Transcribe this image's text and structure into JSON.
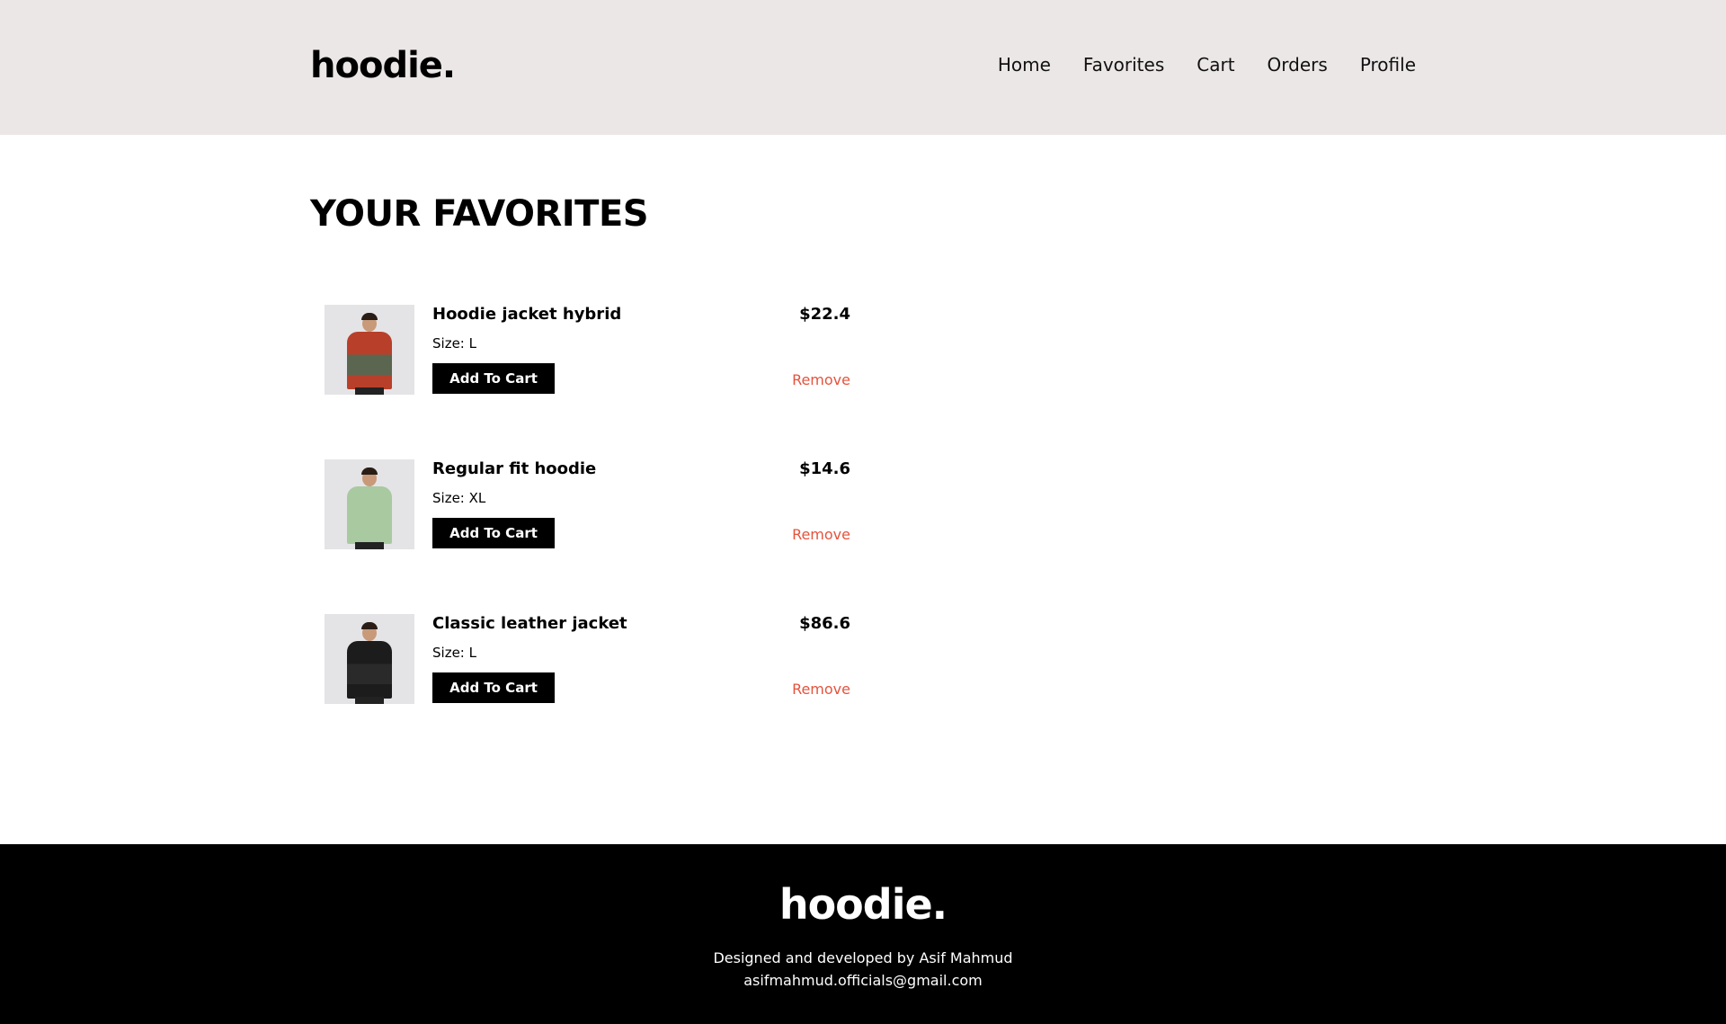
{
  "header": {
    "logo": "hoodie.",
    "nav": [
      "Home",
      "Favorites",
      "Cart",
      "Orders",
      "Profile"
    ]
  },
  "main": {
    "title": "YOUR FAVORITES",
    "items": [
      {
        "name": "Hoodie jacket hybrid",
        "size": "Size: L",
        "price": "$22.4",
        "add_label": "Add To Cart",
        "remove_label": "Remove",
        "colors": [
          "#b8402a",
          "#5a6650"
        ]
      },
      {
        "name": "Regular fit hoodie",
        "size": "Size: XL",
        "price": "$14.6",
        "add_label": "Add To Cart",
        "remove_label": "Remove",
        "colors": [
          "#a9c9a0",
          "#a9c9a0"
        ]
      },
      {
        "name": "Classic leather jacket",
        "size": "Size: L",
        "price": "$86.6",
        "add_label": "Add To Cart",
        "remove_label": "Remove",
        "colors": [
          "#1c1c1c",
          "#2a2a2a"
        ]
      }
    ]
  },
  "footer": {
    "logo": "hoodie.",
    "credit": "Designed and developed by Asif Mahmud",
    "email": "asifmahmud.officials@gmail.com"
  },
  "colors": {
    "header_bg": "#ebe7e6",
    "remove": "#e5533d",
    "button": "#000000"
  }
}
